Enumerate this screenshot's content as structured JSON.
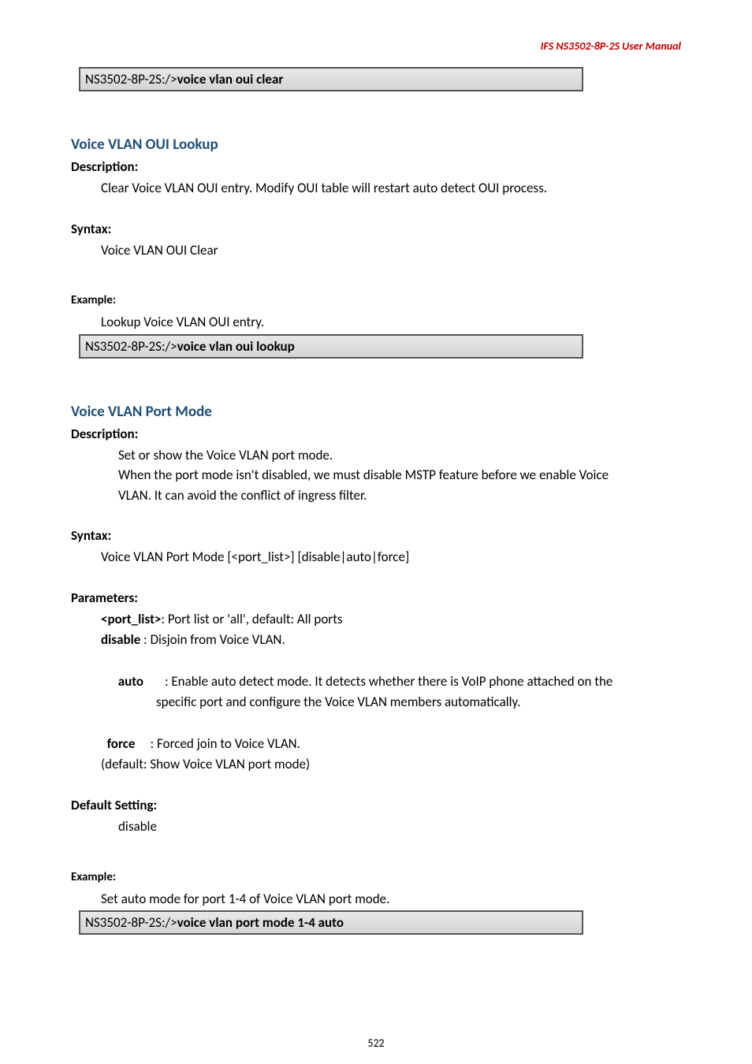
{
  "header": "IFS  NS3502-8P-2S  User  Manual",
  "top_code": {
    "prompt": "NS3502-8P-2S:/>",
    "cmd": "voice vlan oui clear"
  },
  "sec1": {
    "title": "Voice VLAN OUI Lookup",
    "desc_label": "Description:",
    "desc_text": "Clear Voice VLAN OUI entry. Modify OUI table will restart auto detect OUI process.",
    "syntax_label": "Syntax:",
    "syntax_text": "Voice VLAN OUI Clear",
    "example_label": "Example:",
    "example_text": "Lookup Voice VLAN OUI entry.",
    "code": {
      "prompt": "NS3502-8P-2S:/>",
      "cmd": "voice vlan oui lookup"
    }
  },
  "sec2": {
    "title": "Voice VLAN Port Mode",
    "desc_label": "Description:",
    "desc_line1": "Set or show the Voice VLAN port mode.",
    "desc_line2": "When the port mode isn't disabled, we must disable MSTP feature before we enable Voice",
    "desc_line3": "VLAN. It can avoid the conflict of ingress filter.",
    "syntax_label": "Syntax:",
    "syntax_text": "Voice VLAN Port Mode [<port_list>] [disable|auto|force]",
    "params_label": "Parameters:",
    "p_portlist_key": "<port_list>",
    "p_portlist_text": ": Port list or 'all', default: All ports",
    "p_disable_key": "disable",
    "p_disable_text": " : Disjoin from Voice VLAN.",
    "p_auto_key": "auto",
    "p_auto_text1": "       : Enable auto detect mode. It detects whether there is VoIP phone attached on the",
    "p_auto_text2": "specific port and configure the Voice VLAN members automatically.",
    "p_force_key": "force",
    "p_force_text": "     : Forced join to Voice VLAN.",
    "p_default_text": "(default: Show Voice VLAN port mode)",
    "def_label": "Default Setting:",
    "def_text": "disable",
    "example_label": "Example:",
    "example_text": "Set auto mode for port 1-4 of Voice VLAN port mode.",
    "code": {
      "prompt": "NS3502-8P-2S:/>",
      "cmd": "voice vlan port mode 1-4 auto"
    }
  },
  "page_number": "522"
}
